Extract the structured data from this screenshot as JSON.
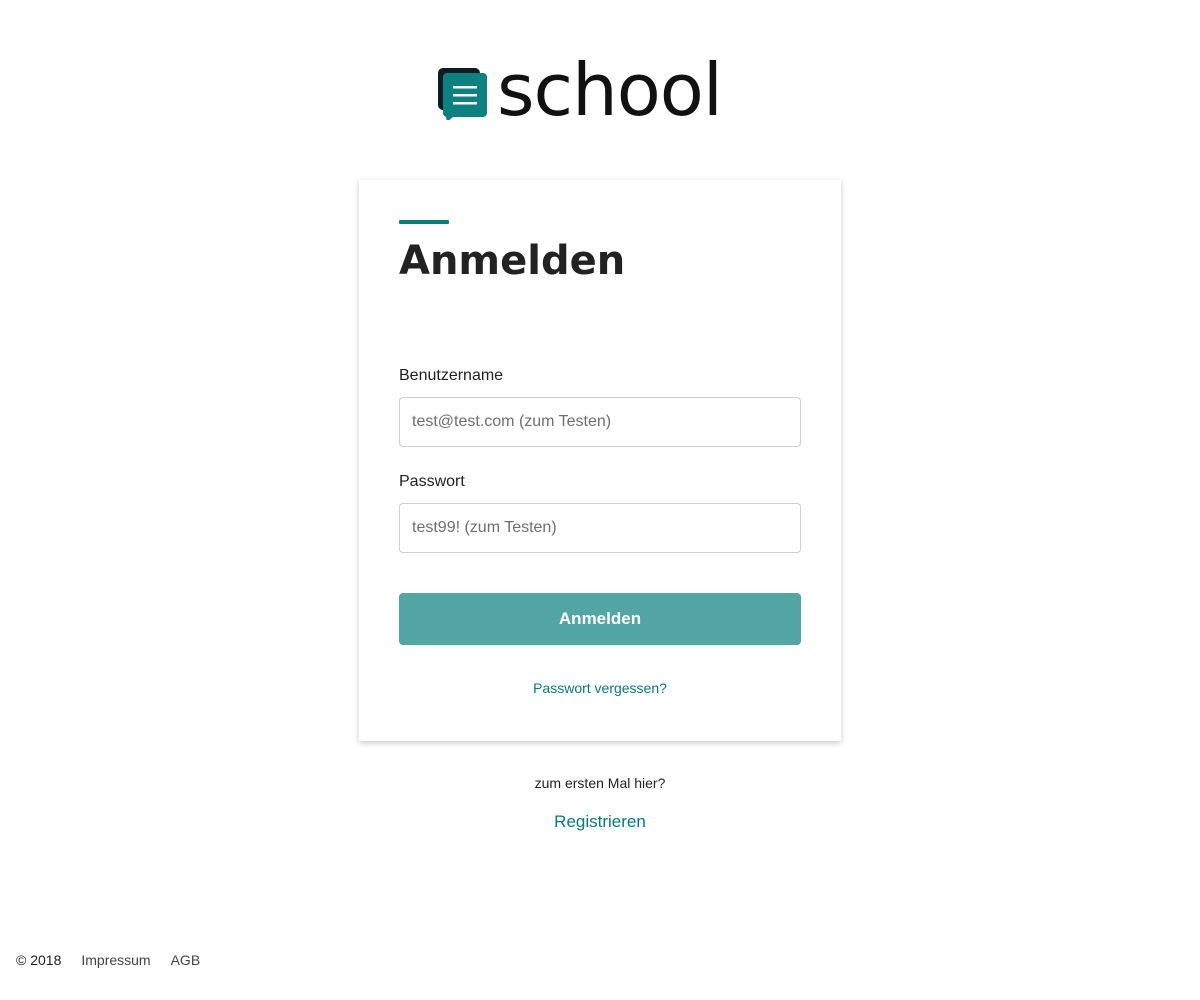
{
  "brand": {
    "logo_icon": "chat-document-icon",
    "name": "school",
    "accent_color": "#0a7a7a",
    "button_color": "#53a6a4"
  },
  "login_card": {
    "title": "Anmelden",
    "username": {
      "label": "Benutzername",
      "placeholder": "test@test.com (zum Testen)",
      "value": ""
    },
    "password": {
      "label": "Passwort",
      "placeholder": "test99! (zum Testen)",
      "value": ""
    },
    "submit_label": "Anmelden",
    "forgot_password": "Passwort vergessen?"
  },
  "signup": {
    "prompt": "zum ersten Mal hier?",
    "register_label": "Registrieren"
  },
  "footer": {
    "copyright": "© 2018",
    "links": [
      "Impressum",
      "AGB"
    ]
  }
}
